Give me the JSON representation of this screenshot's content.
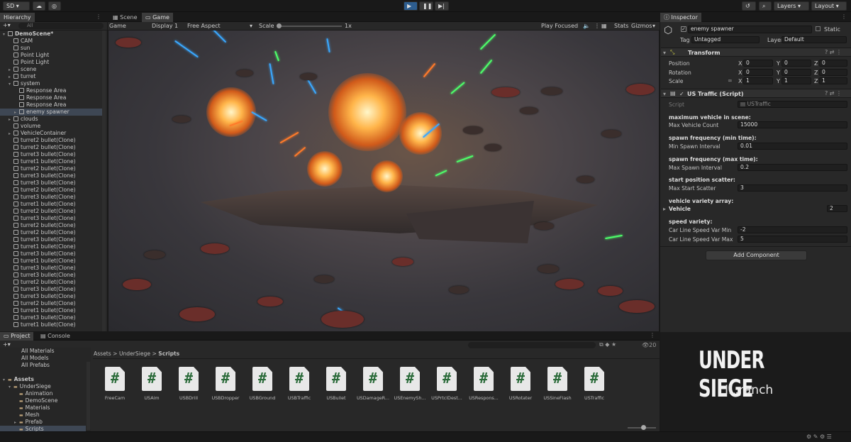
{
  "toolbar": {
    "account": "SD ▾",
    "layers": "Layers",
    "layout": "Layout"
  },
  "hierarchy": {
    "tab": "Hierarchy",
    "search_placeholder": "All",
    "items": [
      {
        "label": "DemoScene*",
        "level": 0
      },
      {
        "label": "CAM",
        "level": 1
      },
      {
        "label": "sun",
        "level": 1
      },
      {
        "label": "Point Light",
        "level": 1
      },
      {
        "label": "Point Light",
        "level": 1
      },
      {
        "label": "scene",
        "level": 1
      },
      {
        "label": "turret",
        "level": 1
      },
      {
        "label": "system",
        "level": 1
      },
      {
        "label": "Response Area",
        "level": 2
      },
      {
        "label": "Response Area",
        "level": 2
      },
      {
        "label": "Response Area",
        "level": 2
      },
      {
        "label": "enemy spawner",
        "level": 2
      },
      {
        "label": "clouds",
        "level": 1
      },
      {
        "label": "volume",
        "level": 1
      },
      {
        "label": "VehicleContainer",
        "level": 1
      },
      {
        "label": "turret2 bullet(Clone)",
        "level": 1
      },
      {
        "label": "turret2 bullet(Clone)",
        "level": 1
      },
      {
        "label": "turret3 bullet(Clone)",
        "level": 1
      },
      {
        "label": "turret1 bullet(Clone)",
        "level": 1
      },
      {
        "label": "turret2 bullet(Clone)",
        "level": 1
      },
      {
        "label": "turret3 bullet(Clone)",
        "level": 1
      },
      {
        "label": "turret3 bullet(Clone)",
        "level": 1
      },
      {
        "label": "turret2 bullet(Clone)",
        "level": 1
      },
      {
        "label": "turret3 bullet(Clone)",
        "level": 1
      },
      {
        "label": "turret1 bullet(Clone)",
        "level": 1
      },
      {
        "label": "turret2 bullet(Clone)",
        "level": 1
      },
      {
        "label": "turret3 bullet(Clone)",
        "level": 1
      },
      {
        "label": "turret2 bullet(Clone)",
        "level": 1
      },
      {
        "label": "turret2 bullet(Clone)",
        "level": 1
      },
      {
        "label": "turret3 bullet(Clone)",
        "level": 1
      },
      {
        "label": "turret1 bullet(Clone)",
        "level": 1
      },
      {
        "label": "turret3 bullet(Clone)",
        "level": 1
      },
      {
        "label": "turret1 bullet(Clone)",
        "level": 1
      },
      {
        "label": "turret3 bullet(Clone)",
        "level": 1
      },
      {
        "label": "turret3 bullet(Clone)",
        "level": 1
      },
      {
        "label": "turret2 bullet(Clone)",
        "level": 1
      },
      {
        "label": "turret3 bullet(Clone)",
        "level": 1
      },
      {
        "label": "turret3 bullet(Clone)",
        "level": 1
      },
      {
        "label": "turret2 bullet(Clone)",
        "level": 1
      },
      {
        "label": "turret1 bullet(Clone)",
        "level": 1
      },
      {
        "label": "turret3 bullet(Clone)",
        "level": 1
      },
      {
        "label": "turret1 bullet(Clone)",
        "level": 1
      }
    ]
  },
  "scene_tabs": {
    "scene": "Scene",
    "game": "Game"
  },
  "game_bar": {
    "display_mode": "Game",
    "display": "Display 1",
    "aspect": "Free Aspect",
    "scale_label": "Scale",
    "scale_value": "1x",
    "play_mode": "Play Focused",
    "stats": "Stats",
    "gizmos": "Gizmos"
  },
  "inspector": {
    "tab": "Inspector",
    "object_name": "enemy spawner",
    "static_label": "Static",
    "tag_label": "Tag",
    "tag_value": "Untagged",
    "layer_label": "Layer",
    "layer_value": "Default",
    "transform": {
      "title": "Transform",
      "position": {
        "label": "Position",
        "x": "0",
        "y": "0",
        "z": "0"
      },
      "rotation": {
        "label": "Rotation",
        "x": "0",
        "y": "0",
        "z": "0"
      },
      "scale": {
        "label": "Scale",
        "x": "1",
        "y": "1",
        "z": "1"
      },
      "axis_x": "X",
      "axis_y": "Y",
      "axis_z": "Z"
    },
    "script_comp": {
      "title": "US Traffic (Script)",
      "script_label": "Script",
      "script_value": "USTraffic",
      "h1": "maximum vehicle in scene:",
      "max_vehicle_label": "Max Vehicle Count",
      "max_vehicle_value": "15000",
      "h2": "spawn frequency (min time):",
      "min_spawn_label": "Min Spawn Interval",
      "min_spawn_value": "0.01",
      "h3": "spawn frequency (max time):",
      "max_spawn_label": "Max Spawn Interval",
      "max_spawn_value": "0.2",
      "h4": "start position scatter:",
      "scatter_label": "Max Start Scatter",
      "scatter_value": "3",
      "h5": "vehicle variety array:",
      "vehicle_label": "Vehicle",
      "vehicle_value": "2",
      "h6": "speed variety:",
      "speed_min_label": "Car Line Speed Var Min",
      "speed_min_value": "-2",
      "speed_max_label": "Car Line Speed Var Max",
      "speed_max_value": "5"
    },
    "add_component": "Add Component"
  },
  "project": {
    "tab_project": "Project",
    "tab_console": "Console",
    "favorites": [
      "All Materials",
      "All Models",
      "All Prefabs"
    ],
    "tree": [
      {
        "label": "Assets",
        "level": 0
      },
      {
        "label": "UnderSiege",
        "level": 1
      },
      {
        "label": "Animation",
        "level": 2
      },
      {
        "label": "DemoScene",
        "level": 2
      },
      {
        "label": "Materials",
        "level": 2
      },
      {
        "label": "Mesh",
        "level": 2
      },
      {
        "label": "Prefab",
        "level": 2
      },
      {
        "label": "Scripts",
        "level": 2
      }
    ],
    "breadcrumb": {
      "a": "Assets",
      "b": "UnderSiege",
      "c": "Scripts",
      "sep": ">"
    },
    "count": "20",
    "assets": [
      "FreeCam",
      "USAim",
      "USBDrill",
      "USBDropper",
      "USBGround",
      "USBTraffic",
      "USBullet",
      "USDamageR...",
      "USEnemySh...",
      "USPrtclDest...",
      "USRespons...",
      "USRotater",
      "USSineFlash",
      "USTraffic"
    ]
  },
  "brand": {
    "title": "UNDER SIEGE",
    "subtitle": "IL.ranch"
  }
}
